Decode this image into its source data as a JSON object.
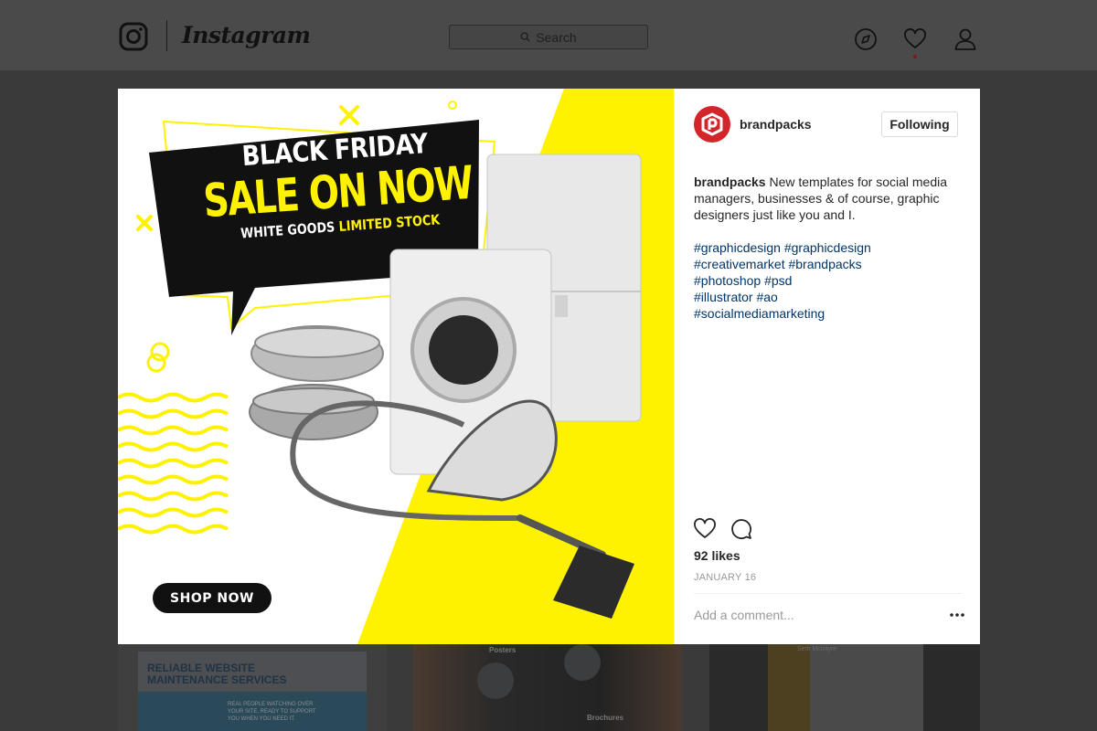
{
  "app": {
    "wordmark": "Instagram"
  },
  "search": {
    "placeholder": "Search"
  },
  "post": {
    "username": "brandpacks",
    "follow_label": "Following",
    "caption_user": "brandpacks",
    "caption_text": "New templates for social media managers, businesses & of course, graphic designers just like you and I.",
    "hashtag_lines": [
      "#graphicdesign #graphicdesign",
      "#creativemarket #brandpacks",
      "#photoshop #psd",
      "#illustrator #ao",
      "#socialmediamarketing"
    ],
    "likes": "92 likes",
    "date": "JANUARY 16",
    "comment_placeholder": "Add a comment..."
  },
  "ad": {
    "line1": "BLACK FRIDAY",
    "line2": "SALE ON NOW",
    "line3_a": "WHITE GOODS ",
    "line3_b": "LIMITED STOCK",
    "cta": "SHOP NOW",
    "colors": {
      "yellow": "#fff200",
      "black": "#111111"
    }
  },
  "background_thumbs": {
    "thumb1_title_1": "RELIABLE WEBSITE",
    "thumb1_title_2": "MAINTENANCE SERVICES",
    "thumb1_text": "REAL PEOPLE WATCHING OVER YOUR SITE, READY TO SUPPORT YOU WHEN YOU NEED IT.",
    "thumb2_label_1": "Posters",
    "thumb2_label_2": "Brochures",
    "thumb3_name": "Seth McIntyre"
  },
  "colors": {
    "brand_red": "#d3262b",
    "link": "#003569",
    "overlay": "#3a3a3a"
  }
}
